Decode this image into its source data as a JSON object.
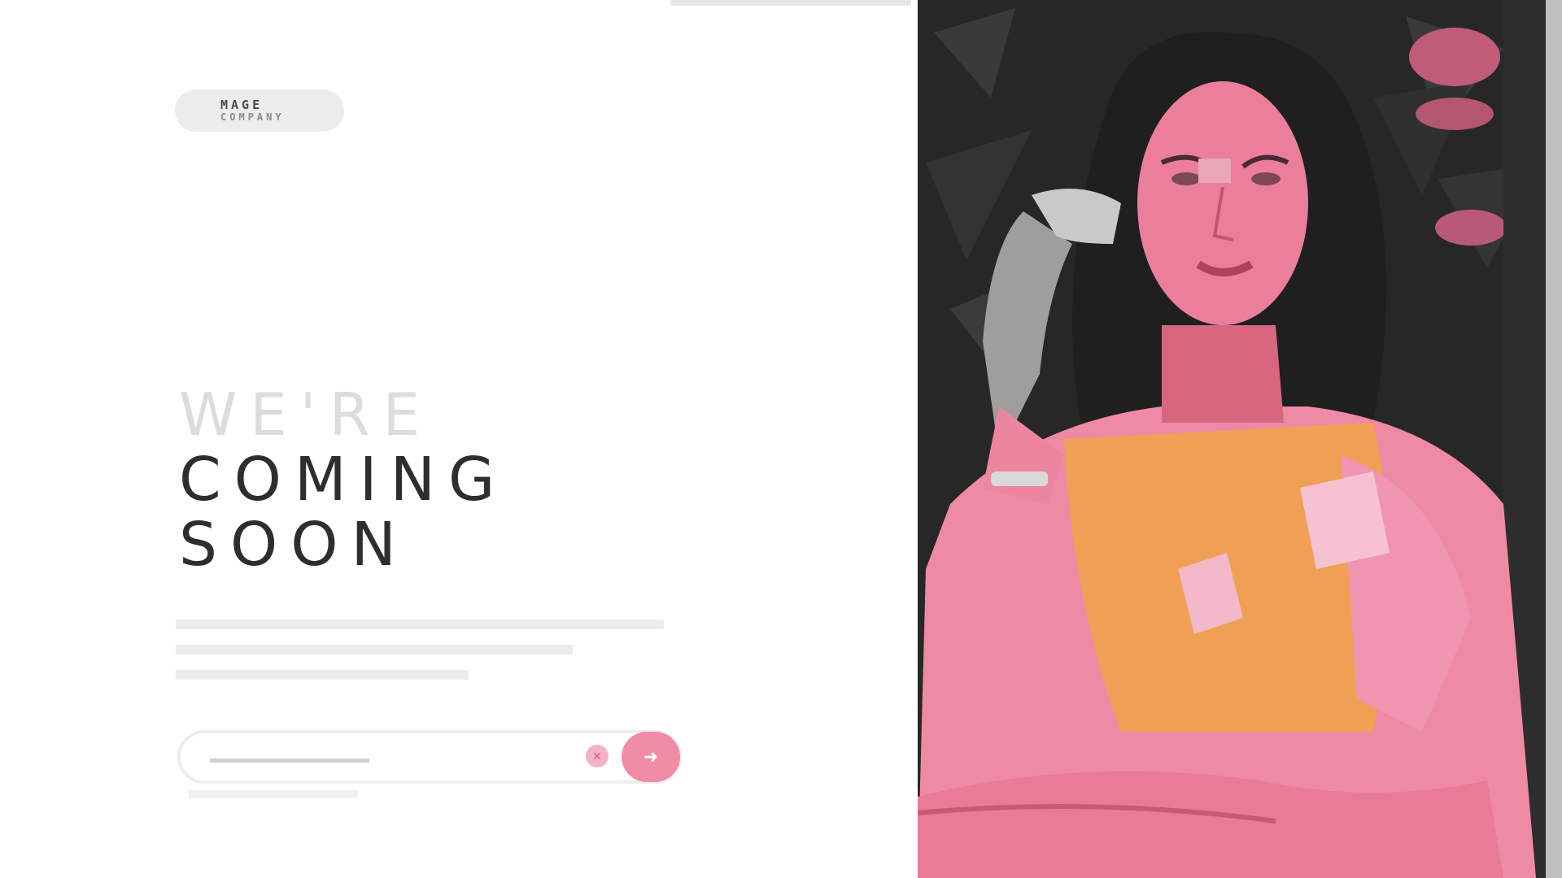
{
  "logo": {
    "line1": "MAGE",
    "line2": "COMPANY"
  },
  "headline": {
    "line1": "WE'RE",
    "line2": "COMING",
    "line3": "SOON"
  },
  "description": {
    "lines": [
      "",
      "",
      ""
    ]
  },
  "subscribe": {
    "placeholder": "",
    "clear_icon": "close-icon",
    "submit_icon": "arrow-right-icon",
    "note": ""
  },
  "colors": {
    "accent": "#f08ca6",
    "heading_dark": "#2e2e2e",
    "heading_light": "#dcdcdc",
    "shirt": "#f2a05a",
    "skin": "#ef8fa8",
    "background_photo": "#262626"
  }
}
